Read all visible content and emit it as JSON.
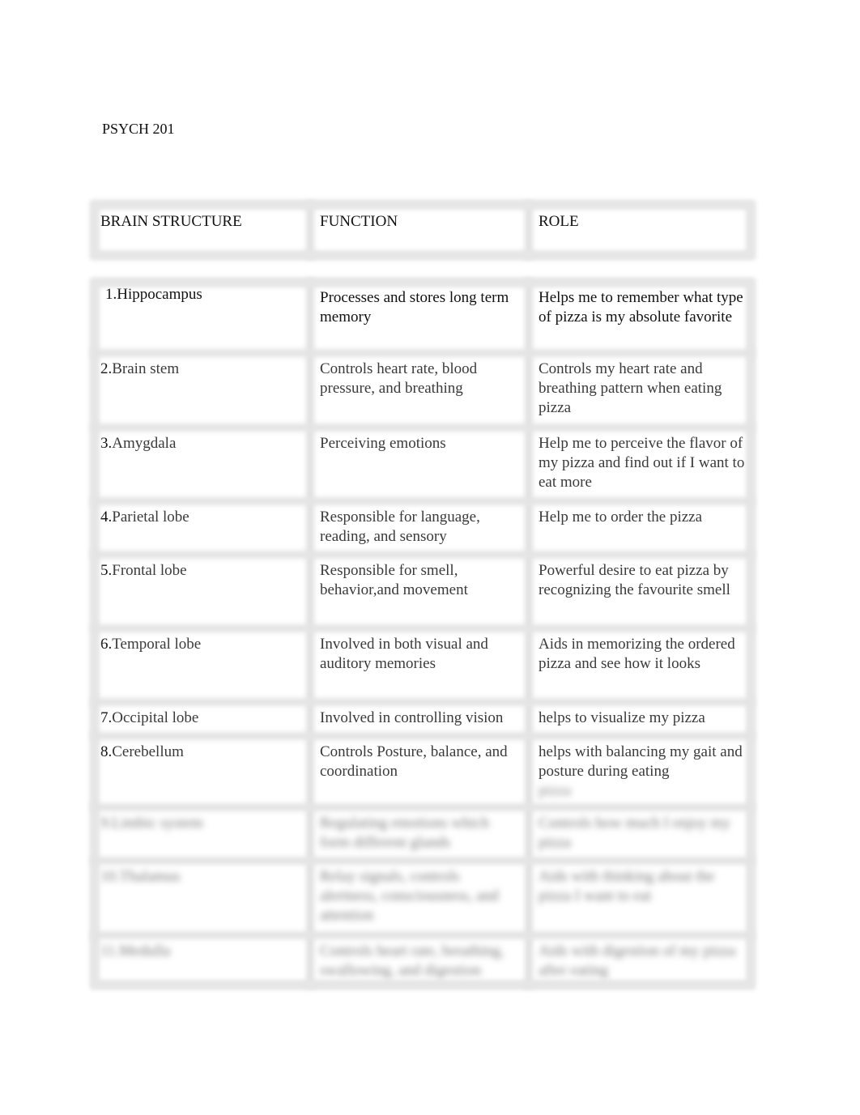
{
  "document": {
    "course": "PSYCH 201",
    "table": {
      "headers": [
        "BRAIN STRUCTURE",
        "FUNCTION",
        "ROLE"
      ],
      "rows": [
        {
          "num": "1.",
          "structure": "Hippocampus",
          "function": "Processes and stores long term memory",
          "role": "Helps me to remember what type of pizza is my absolute favorite"
        },
        {
          "num": "2.",
          "structure": "Brain stem",
          "function": "Controls heart rate, blood pressure, and breathing",
          "role": "Controls my heart rate and breathing pattern when eating pizza"
        },
        {
          "num": "3.",
          "structure": "Amygdala",
          "function": "Perceiving emotions",
          "role": "Help me to perceive the flavor of my pizza and find out if I want to eat more"
        },
        {
          "num": "4.",
          "structure": "Parietal lobe",
          "function": "Responsible for language, reading, and sensory",
          "role": "Help me to order the pizza"
        },
        {
          "num": "5.",
          "structure": "Frontal lobe",
          "function": "Responsible for smell, behavior,and movement",
          "role": "Powerful desire to eat pizza by recognizing the favourite smell"
        },
        {
          "num": "6.",
          "structure": "Temporal lobe",
          "function": "Involved in both visual and auditory memories",
          "role": "Aids in memorizing the ordered pizza and see how it looks"
        },
        {
          "num": "7.",
          "structure": "Occipital lobe",
          "function": "Involved in controlling vision",
          "role": "helps to visualize my pizza"
        },
        {
          "num": "8.",
          "structure": "Cerebellum",
          "function": "Controls Posture, balance, and coordination",
          "role": "helps with balancing my gait and posture during eating",
          "role_hidden": "pizza"
        }
      ],
      "blurred_rows": [
        {
          "structure": "9.Limbic system",
          "function": "Regulating emotions which form different glands",
          "role": "Controls how much I enjoy my pizza"
        },
        {
          "structure": "10.Thalamus",
          "function": "Relay signals, controls alertness, consciousness, and attention",
          "role": "Aids with thinking about the pizza I want to eat"
        },
        {
          "structure": "11.Medulla",
          "function": "Controls heart rate, breathing, swallowing, and digestion",
          "role": "Aids with digestion of my pizza after eating"
        }
      ]
    }
  }
}
